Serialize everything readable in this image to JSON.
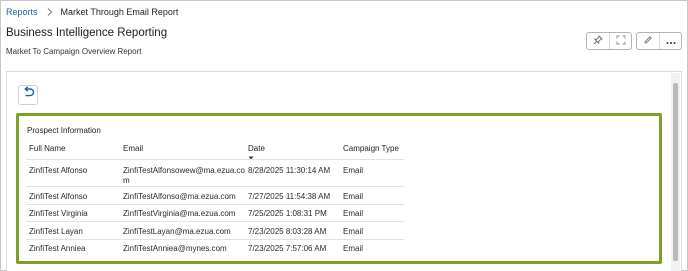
{
  "breadcrumb": {
    "root": "Reports",
    "current": "Market Through Email Report"
  },
  "header": {
    "title": "Business Intelligence Reporting",
    "subtitle": "Market To Campaign Overview Report"
  },
  "toolbar": {
    "icons": [
      "pin-icon",
      "fullscreen-icon",
      "edit-icon",
      "more-icon"
    ]
  },
  "colors": {
    "accent": "#1f5ea8",
    "highlight_border": "#7ea123"
  },
  "report": {
    "section_title": "Prospect Information",
    "columns": [
      "Full Name",
      "Email",
      "Date",
      "Campaign Type"
    ],
    "rows": [
      {
        "name": "ZinfiTest Alfonso",
        "email": "ZinfiTestAlfonsowew@ma.ezua.co",
        "email2": "m",
        "date": "8/28/2025 11:30:14 AM",
        "type": "Email"
      },
      {
        "name": "ZinfiTest Alfonso",
        "email": "ZinfiTestAlfonso@ma.ezua.com",
        "date": "7/27/2025 11:54:38 AM",
        "type": "Email"
      },
      {
        "name": "ZinfiTest Virginia",
        "email": "ZinfiTestVirginia@ma.ezua.com",
        "date": "7/25/2025 1:08:31 PM",
        "type": "Email"
      },
      {
        "name": "ZinfiTest Layan",
        "email": "ZinfiTestLayan@ma.ezua.com",
        "date": "7/23/2025 8:03:28 AM",
        "type": "Email"
      },
      {
        "name": "ZinfiTest Anniea",
        "email": "ZinfiTestAnniea@mynes.com",
        "date": "7/23/2025 7:57:06 AM",
        "type": "Email"
      }
    ]
  }
}
